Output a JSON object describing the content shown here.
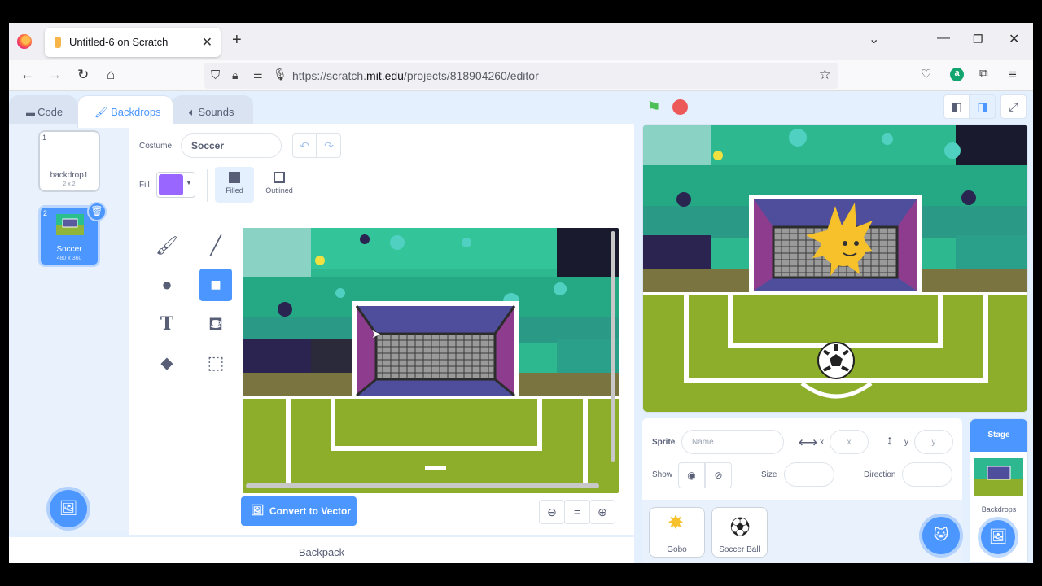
{
  "browser": {
    "tab_title": "Untitled-6 on Scratch",
    "url_prefix": "https://scratch.",
    "url_domain": "mit.edu",
    "url_path": "/projects/818904260/editor"
  },
  "scratch": {
    "tabs": [
      "Code",
      "Backdrops",
      "Sounds"
    ],
    "active_tab": "Backdrops",
    "costumes": [
      {
        "num": "1",
        "name": "backdrop1",
        "size": "2 x 2"
      },
      {
        "num": "2",
        "name": "Soccer",
        "size": "480 x 360"
      }
    ],
    "editor": {
      "costume_label": "Costume",
      "costume_name": "Soccer",
      "fill_label": "Fill",
      "fill_color": "#9966ff",
      "filled_label": "Filled",
      "outlined_label": "Outlined",
      "convert_label": "Convert to Vector",
      "zoom_reset": "="
    },
    "backpack_label": "Backpack",
    "sprite_info": {
      "sprite_label": "Sprite",
      "name_placeholder": "Name",
      "x_label": "x",
      "x_value": "x",
      "y_label": "y",
      "y_value": "y",
      "show_label": "Show",
      "size_label": "Size",
      "direction_label": "Direction"
    },
    "sprites": [
      {
        "name": "Gobo"
      },
      {
        "name": "Soccer Ball"
      }
    ],
    "stage_panel": {
      "title": "Stage",
      "backdrops_label": "Backdrops"
    }
  }
}
